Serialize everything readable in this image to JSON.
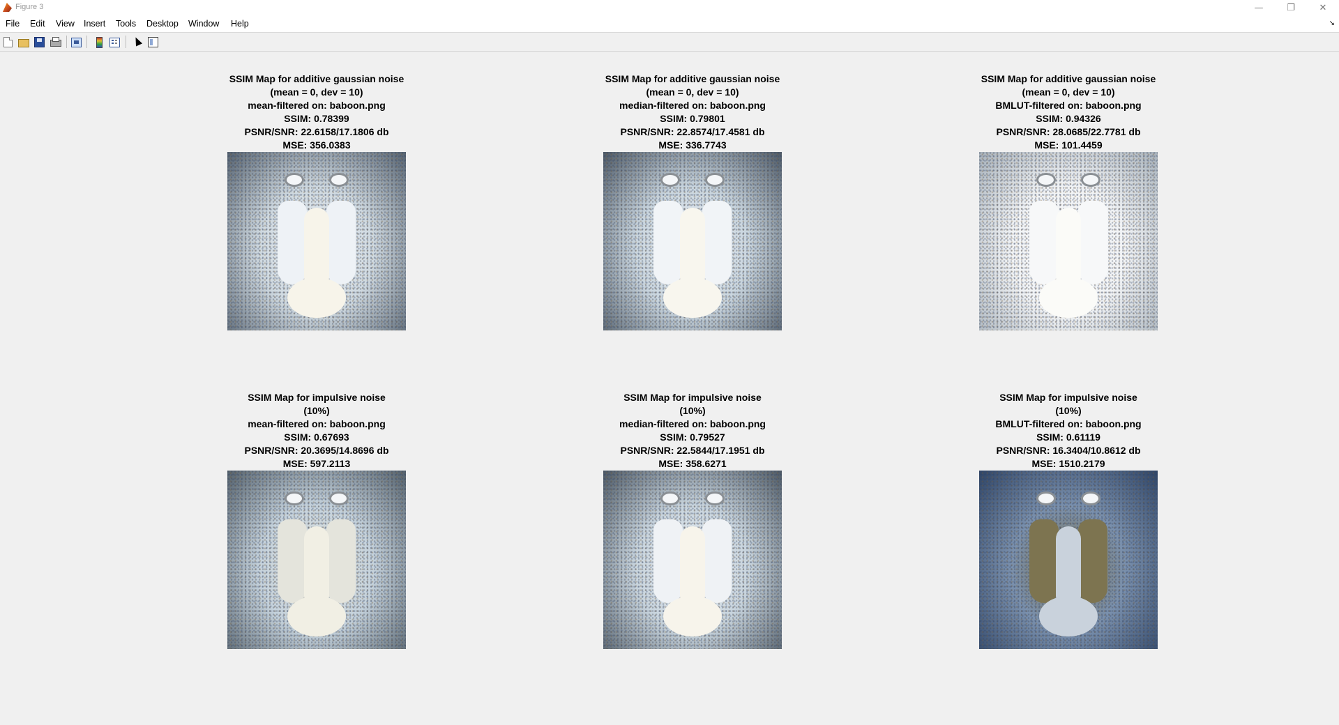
{
  "window": {
    "title": "Figure 3",
    "controls": [
      "minimize-icon",
      "restore-icon",
      "close-icon"
    ]
  },
  "menu": [
    "File",
    "Edit",
    "View",
    "Insert",
    "Tools",
    "Desktop",
    "Window",
    "Help"
  ],
  "toolbar": {
    "icons": [
      "new-figure-icon",
      "open-icon",
      "save-icon",
      "print-icon",
      "link-plot-icon",
      "colorbar-icon",
      "legend-icon",
      "pointer-icon",
      "plot-tools-icon"
    ]
  },
  "subplots": [
    {
      "lines": [
        "SSIM Map for additive gaussian noise",
        "(mean = 0, dev = 10)",
        "mean-filtered on: baboon.png",
        "SSIM: 0.78399",
        "PSNR/SNR: 22.6158/17.1806 db",
        "MSE: 356.0383"
      ],
      "tone": "#cfd9e0",
      "dark": "#556270",
      "cheek": "#eef2f6",
      "muzzle": "#f7f4ea"
    },
    {
      "lines": [
        "SSIM Map for additive gaussian noise",
        "(mean = 0, dev = 10)",
        "median-filtered on: baboon.png",
        "SSIM: 0.79801",
        "PSNR/SNR: 22.8574/17.4581 db",
        "MSE: 336.7743"
      ],
      "tone": "#c9d5de",
      "dark": "#4d5966",
      "cheek": "#f1f4f7",
      "muzzle": "#f8f6ee"
    },
    {
      "lines": [
        "SSIM Map for additive gaussian noise",
        "(mean = 0, dev = 10)",
        "BMLUT-filtered on: baboon.png",
        "SSIM: 0.94326",
        "PSNR/SNR: 28.0685/22.7781 db",
        "MSE: 101.4459"
      ],
      "tone": "#f1f3f5",
      "dark": "#a7b1ba",
      "cheek": "#f7f8f9",
      "muzzle": "#fbfbf8"
    },
    {
      "lines": [
        "SSIM Map for impulsive noise",
        "(10%)",
        "mean-filtered on: baboon.png",
        "SSIM: 0.67693",
        "PSNR/SNR: 20.3695/14.8696 db",
        "MSE: 597.2113"
      ],
      "tone": "#c5d2dc",
      "dark": "#53606b",
      "cheek": "#e4e4dc",
      "muzzle": "#f1efe4"
    },
    {
      "lines": [
        "SSIM Map for impulsive noise",
        "(10%)",
        "median-filtered on: baboon.png",
        "SSIM: 0.79527",
        "PSNR/SNR: 22.5844/17.1951 db",
        "MSE: 358.6271"
      ],
      "tone": "#c8d4dd",
      "dark": "#4c5864",
      "cheek": "#eff2f5",
      "muzzle": "#f7f4eb"
    },
    {
      "lines": [
        "SSIM Map for impulsive noise",
        "(10%)",
        "BMLUT-filtered on: baboon.png",
        "SSIM: 0.61119",
        "PSNR/SNR: 16.3404/10.8612 db",
        "MSE: 1510.2179"
      ],
      "tone": "#7a90ad",
      "dark": "#2e4466",
      "cheek": "#7d7450",
      "muzzle": "#c9d2dc"
    }
  ]
}
